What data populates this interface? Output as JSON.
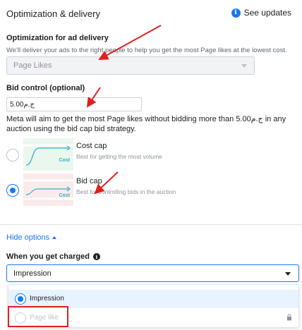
{
  "header": {
    "title": "Optimization & delivery",
    "see_updates": "See updates",
    "info_glyph": "i"
  },
  "optimization": {
    "title": "Optimization for ad delivery",
    "subtitle": "We'll deliver your ads to the right people to help you get the most Page likes at the lowest cost.",
    "selected_value": "Page Likes"
  },
  "bid_control": {
    "title": "Bid control (optional)",
    "value": "5.00ج.م",
    "description": "Meta will aim to get the most Page likes without bidding more than 5.00ج.م in any auction using the bid cap bid strategy."
  },
  "strategies": [
    {
      "name": "Cost cap",
      "description": "Best for getting the most volume",
      "thumb_label": "Cost",
      "checked": false
    },
    {
      "name": "Bid cap",
      "description": "Best for controlling bids in the auction",
      "thumb_label": "Cost",
      "checked": true
    }
  ],
  "hide_options": "Hide options",
  "charged": {
    "label": "When you get charged",
    "info_glyph": "i",
    "selected": "Impression",
    "options": [
      {
        "label": "Impression",
        "checked": true,
        "disabled": false
      },
      {
        "label": "Page like",
        "checked": false,
        "disabled": true
      }
    ]
  },
  "colors": {
    "accent": "#1877f2",
    "annotation": "#e02020",
    "cost_cap_thumb": "#eaf7ee",
    "bid_cap_thumb": "#fbeaea"
  },
  "icons": [
    "info-icon",
    "chevron-down-icon",
    "chevron-up-icon",
    "lock-icon"
  ]
}
